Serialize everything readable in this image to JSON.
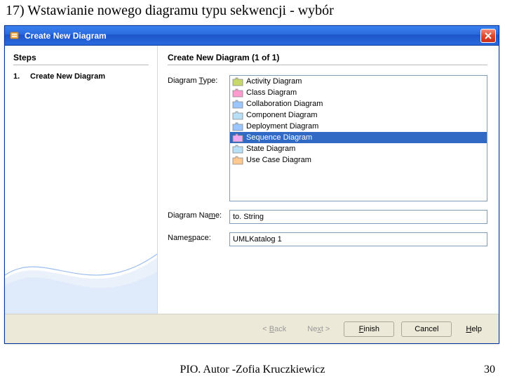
{
  "slide_title": "17) Wstawianie nowego diagramu typu sekwencji - wybór",
  "window": {
    "title": "Create New Diagram"
  },
  "left": {
    "steps_heading": "Steps",
    "step_num": "1.",
    "step_label": "Create New Diagram"
  },
  "right": {
    "page_heading": "Create New Diagram (1 of 1)",
    "type_label_pre": "Diagram ",
    "type_label_ul": "T",
    "type_label_post": "ype:",
    "diagram_types": [
      "Activity Diagram",
      "Class Diagram",
      "Collaboration Diagram",
      "Component Diagram",
      "Deployment Diagram",
      "Sequence Diagram",
      "State Diagram",
      "Use Case Diagram"
    ],
    "selected_index": 5,
    "name_label_pre": "Diagram Na",
    "name_label_ul": "m",
    "name_label_post": "e:",
    "name_value": "to. String",
    "ns_label_pre": "Name",
    "ns_label_ul": "s",
    "ns_label_post": "pace:",
    "ns_value": "UMLKatalog 1"
  },
  "buttons": {
    "back_pre": "< ",
    "back_ul": "B",
    "back_post": "ack",
    "next_pre": "Ne",
    "next_ul": "x",
    "next_post": "t >",
    "finish_ul": "F",
    "finish_post": "inish",
    "cancel": "Cancel",
    "help_ul": "H",
    "help_post": "elp"
  },
  "footer": {
    "author": "PIO. Autor -Zofia Kruczkiewicz",
    "page": "30"
  }
}
